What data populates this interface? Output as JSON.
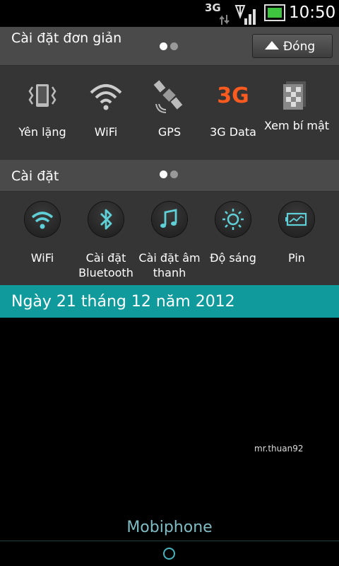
{
  "status_bar": {
    "network": "3G",
    "time": "10:50",
    "icons": [
      "data-arrows-icon",
      "signal-icon",
      "battery-icon"
    ]
  },
  "simple_settings": {
    "title": "Cài đặt đơn giản",
    "close_label": "Đóng",
    "tiles": [
      {
        "icon": "vibrate-icon",
        "label": "Yên lặng"
      },
      {
        "icon": "wifi-icon",
        "label": "WiFi"
      },
      {
        "icon": "gps-satellite-icon",
        "label": "GPS"
      },
      {
        "icon": "3g-icon",
        "icon_text": "3G",
        "label": "3G Data"
      },
      {
        "icon": "privacy-pattern-icon",
        "label": "Xem bí mật"
      }
    ]
  },
  "settings": {
    "title": "Cài đặt",
    "tiles": [
      {
        "icon": "wifi-icon",
        "label": "WiFi"
      },
      {
        "icon": "bluetooth-icon",
        "label": "Cài đặt Bluetooth"
      },
      {
        "icon": "music-note-icon",
        "label": "Cài đặt âm thanh"
      },
      {
        "icon": "brightness-icon",
        "label": "Độ sáng"
      },
      {
        "icon": "battery-chart-icon",
        "label": "Pin"
      }
    ]
  },
  "date_bar": {
    "text": "Ngày 21 tháng 12 năm 2012"
  },
  "watermark": "mr.thuan92",
  "carrier": "Mobiphone",
  "colors": {
    "accent": "#119a9c",
    "icon_teal": "#5fd0d8",
    "orange_3g": "#ff5a1f",
    "panel_header": "#4a4a4a",
    "panel_body": "#353535"
  }
}
